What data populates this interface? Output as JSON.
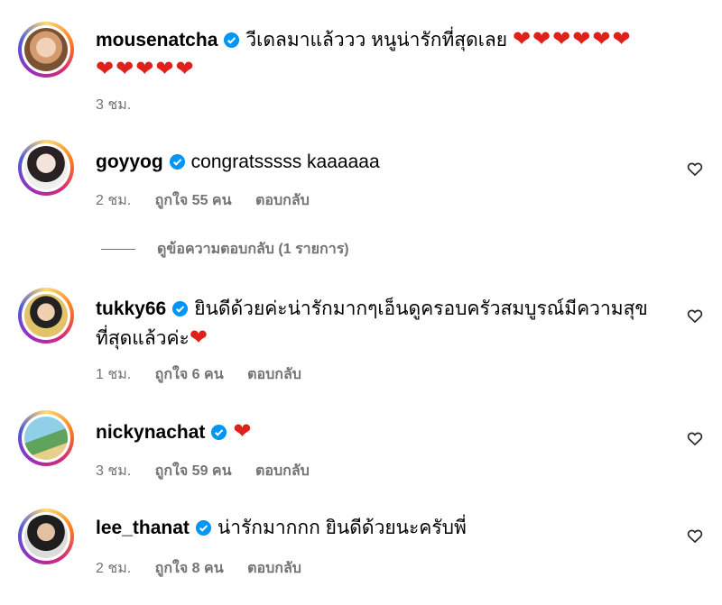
{
  "comments": [
    {
      "username": "mousenatcha",
      "text": "วีเดลมาแล้ววว หนูน่ารักที่สุดเลย",
      "hearts_line1": "❤❤❤❤❤❤",
      "hearts_line2": "❤❤❤❤❤",
      "time": "3 ชม.",
      "likes": "",
      "reply": ""
    },
    {
      "username": "goyyog",
      "text": "congratsssss kaaaaaa",
      "time": "2 ชม.",
      "likes": "ถูกใจ 55 คน",
      "reply": "ตอบกลับ"
    },
    {
      "username": "tukky66",
      "text_line1": "ยินดีด้วยค่ะน่ารักมากๆเอ็นดูครอบครัวสมบูรณ์มีความสุข",
      "text_line2": "ที่สุดแล้วค่ะ",
      "heart": "❤",
      "time": "1 ชม.",
      "likes": "ถูกใจ 6 คน",
      "reply": "ตอบกลับ"
    },
    {
      "username": "nickynachat",
      "heart": "❤",
      "time": "3 ชม.",
      "likes": "ถูกใจ 59 คน",
      "reply": "ตอบกลับ"
    },
    {
      "username": "lee_thanat",
      "text": "น่ารักมากกก ยินดีด้วยนะครับพี่",
      "time": "2 ชม.",
      "likes": "ถูกใจ 8 คน",
      "reply": "ตอบกลับ"
    }
  ],
  "view_replies": "ดูข้อความตอบกลับ (1 รายการ)",
  "colors": {
    "verified": "#0095f6",
    "heart": "#e0211b",
    "meta": "#737373"
  },
  "icons": {
    "verified": "verified-badge-icon",
    "like": "heart-outline-icon"
  }
}
